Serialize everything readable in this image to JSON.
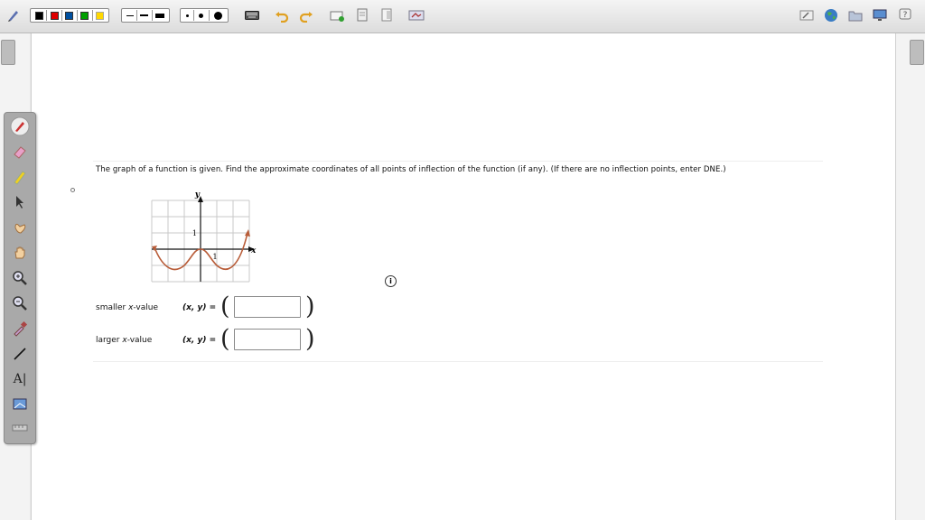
{
  "toolbar": {
    "colors": [
      "#000000",
      "#e00000",
      "#0050a0",
      "#00a000",
      "#ffd800"
    ],
    "line_widths": [
      "thin",
      "medium",
      "thick"
    ],
    "dot_sizes": [
      "small",
      "medium",
      "large"
    ]
  },
  "question": {
    "text": "The graph of a function is given. Find the approximate coordinates of all points of inflection of the function (if any). (If there are no inflection points, enter DNE.)"
  },
  "graph": {
    "y_axis_label": "y",
    "x_axis_label": "x",
    "y_tick_label": "1",
    "x_tick_label": "1",
    "curve_color": "#b85c38"
  },
  "answers": [
    {
      "label_pre": "smaller ",
      "label_var": "x",
      "label_post": "-value",
      "eq": "(x, y) =",
      "value": ""
    },
    {
      "label_pre": "larger ",
      "label_var": "x",
      "label_post": "-value",
      "eq": "(x, y) =",
      "value": ""
    }
  ],
  "info_icon_glyph": "i",
  "tool_text_label": "A|",
  "parens": {
    "open": "(",
    "close": ")"
  }
}
